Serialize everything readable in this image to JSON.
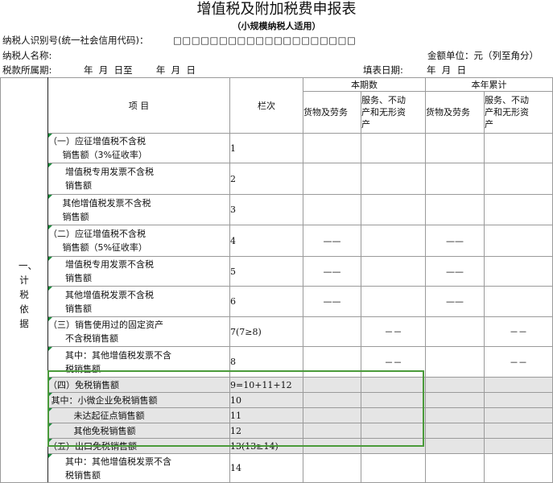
{
  "form": {
    "title": "增值税及附加税费申报表",
    "subtitle": "（小规模纳税人适用）",
    "taxpayer_id_label": "纳税人识别号(统一社会信用代码)：",
    "taxpayer_id_boxes": "□□□□□□□□□□□□□□□□□□□□",
    "taxpayer_name_label": "纳税人名称:",
    "amount_unit_label": "金额单位：元（列至角分）",
    "period_label": "税款所属期:",
    "period_value": "年  月  日至        年  月  日",
    "fill_date_label": "填表日期:",
    "fill_date_value": "年  月  日"
  },
  "table": {
    "side_label": "一、计税依据",
    "col_item": "项  目",
    "col_row": "栏次",
    "group_current": "本期数",
    "group_ytd": "本年累计",
    "sub_goods": "货物及劳务",
    "sub_services": "服务、不动\n产和无形资\n产",
    "dash_long": "——",
    "dash_short": "－－",
    "rows": [
      {
        "item": "（一）应征增值税不含税\n     销售额（3%征收率）",
        "code": "1"
      },
      {
        "item": "      增值税专用发票不含税\n      销售额",
        "code": "2"
      },
      {
        "item": "     其他增值税发票不含税\n     销售额",
        "code": "3"
      },
      {
        "item": "（二）应征增值税不含税\n     销售额（5%征收率）",
        "code": "4"
      },
      {
        "item": "      增值税专用发票不含税\n      销售额",
        "code": "5"
      },
      {
        "item": "      其他增值税发票不含税\n      销售额",
        "code": "6"
      },
      {
        "item": "（三）销售使用过的固定资产\n      不含税销售额",
        "code": "7(7≥8)"
      },
      {
        "item": "      其中：其他增值税发票不含\n      税销售额",
        "code": "8"
      },
      {
        "item": "（四）免税销售额",
        "code": "9=10+11+12"
      },
      {
        "item": " 其中：小微企业免税销售额",
        "code": "10"
      },
      {
        "item": "         未达起征点销售额",
        "code": "11"
      },
      {
        "item": "         其他免税销售额",
        "code": "12"
      },
      {
        "item": "（五）出口免税销售额",
        "code": "13(13≥14)"
      },
      {
        "item": "      其中：其他增值税发票不含\n      税销售额",
        "code": "14"
      }
    ]
  }
}
